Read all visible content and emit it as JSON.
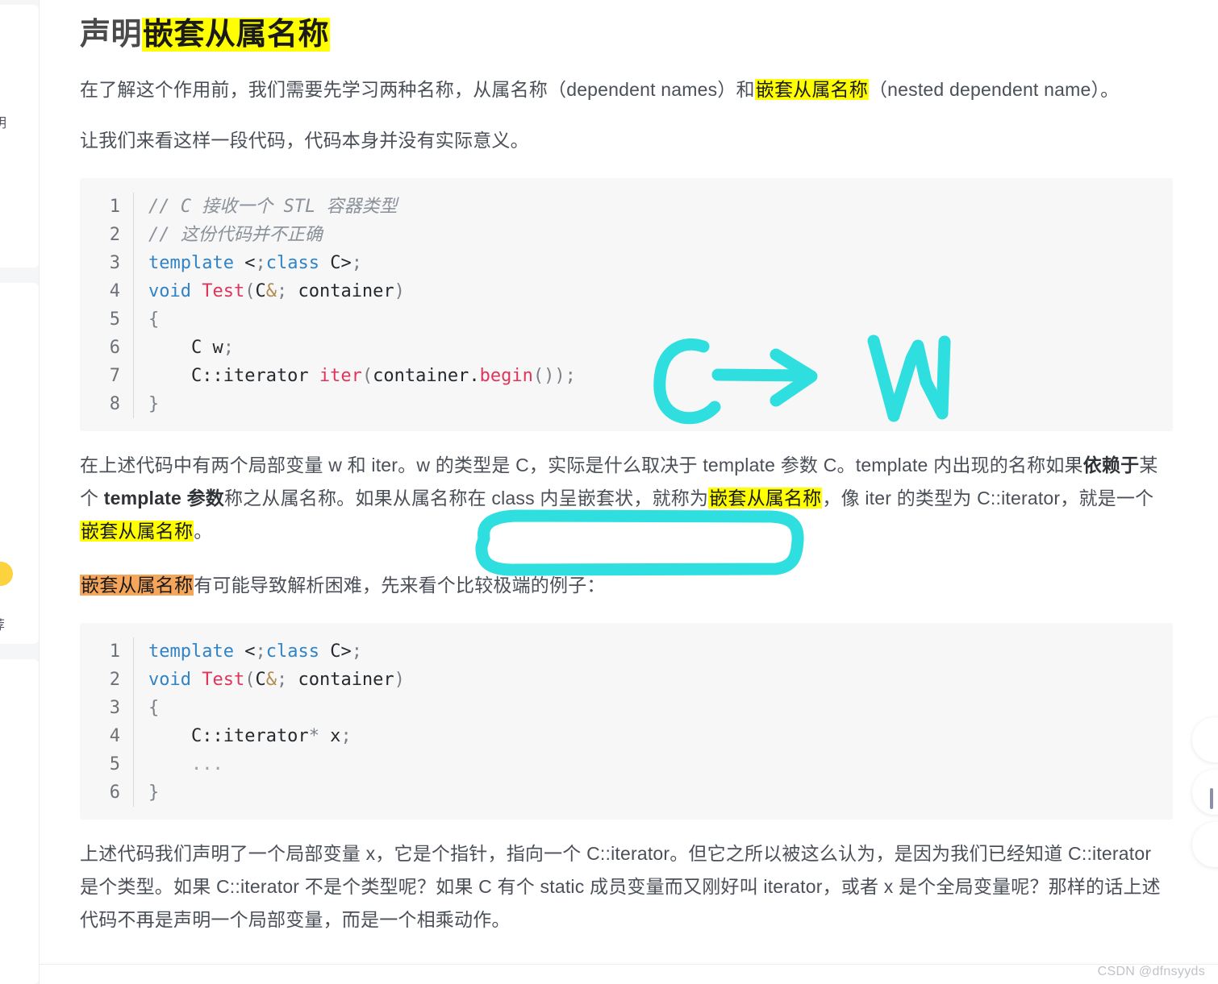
{
  "chrome": {
    "search_placeholder": "",
    "search_button_color": "#fc5531",
    "dropdown_panel": "",
    "top_button_color": "#fc5531"
  },
  "sidebar": {
    "clipped_text_1": "明",
    "clipped_text_2": "荐",
    "badge_color": "#fdd23f"
  },
  "article": {
    "title_prefix": "声明",
    "title_highlight": "嵌套从属名称",
    "paragraph_1": {
      "part_1": "在了解这个作用前，我们需要先学习两种名称，从属名称（dependent names）和",
      "highlight": "嵌套从属名称",
      "part_2": "（nested dependent name）。"
    },
    "paragraph_2": "让我们来看这样一段代码，代码本身并没有实际意义。",
    "paragraph_3": {
      "part_1": "在上述代码中有两个局部变量 w 和 iter。w 的类型是 C，实际是什么取决于 template 参数 C。template 内出现的名称如果",
      "bold_1": "依赖于",
      "part_2": "某个 ",
      "bold_2": "template 参数",
      "part_3": "称之从属名称。如果从属名称在 class 内呈嵌套状，就称为",
      "highlight_1": "嵌套从属名称",
      "part_4": "，像 iter 的类型为 C::iterator，就是一个",
      "highlight_2": "嵌套从属名称",
      "part_5": "。"
    },
    "paragraph_4": {
      "highlight": "嵌套从属名称",
      "part_1": "有可能导致解析困难，先来看个比较极端的例子："
    },
    "paragraph_5": "上述代码我们声明了一个局部变量 x，它是个指针，指向一个 C::iterator。但它之所以被这么认为，是因为我们已经知道 C::iterator 是个类型。如果 C::iterator 不是个类型呢？如果 C 有个 static 成员变量而又刚好叫 iterator，或者 x 是个全局变量呢？那样的话上述代码不再是声明一个局部变量，而是一个相乘动作。"
  },
  "code_block_1": {
    "line_numbers": [
      "1",
      "2",
      "3",
      "4",
      "5",
      "6",
      "7",
      "8"
    ],
    "lines": [
      "// C 接收一个 STL 容器类型",
      "// 这份代码并不正确",
      "template <class C>",
      "void Test(C& container)",
      "{",
      "    C w;",
      "    C::iterator iter(container.begin());",
      "}"
    ]
  },
  "code_block_2": {
    "line_numbers": [
      "1",
      "2",
      "3",
      "4",
      "5",
      "6"
    ],
    "lines": [
      "template <class C>",
      "void Test(C& container)",
      "{",
      "    C::iterator* x;",
      "    ...",
      "}"
    ]
  },
  "annotations": {
    "ink_color": "#2fdfdf",
    "arrow_note": "C → W",
    "arrow_left_letter": "C",
    "arrow_right_letter": "W",
    "circled_text": "如果从属名称在 class 内呈嵌套状，"
  },
  "watermark": "CSDN @dfnsyyds"
}
